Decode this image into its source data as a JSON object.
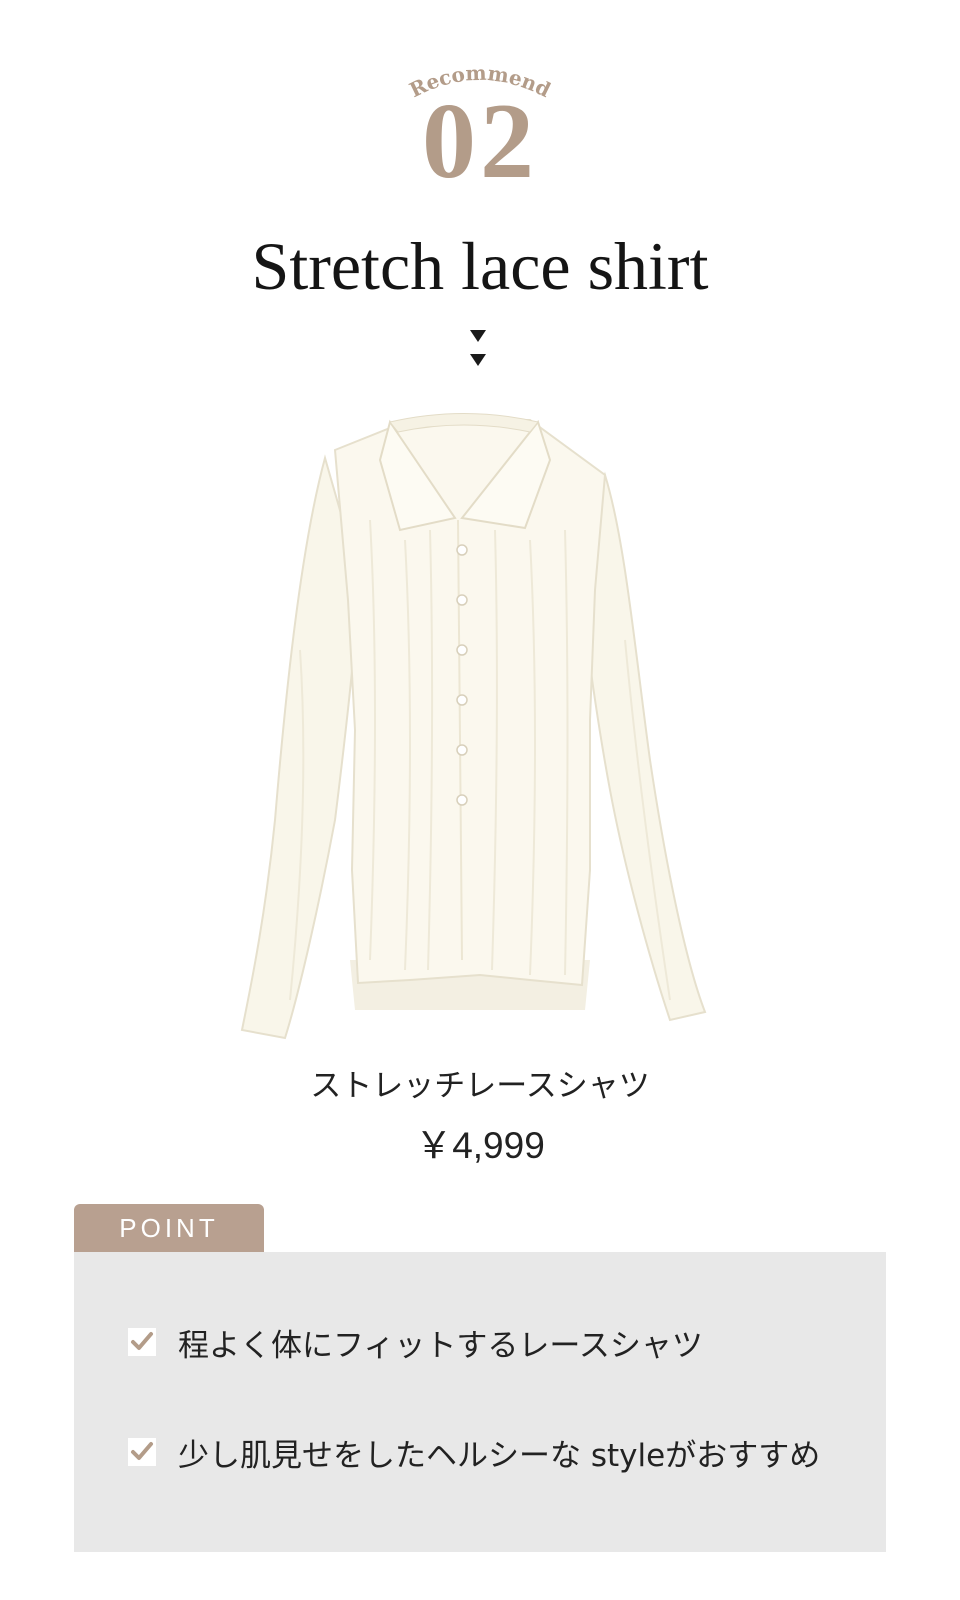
{
  "header": {
    "eyebrow": "Recommend",
    "number": "02",
    "title": "Stretch lace shirt"
  },
  "product": {
    "name": "ストレッチレースシャツ",
    "price": "￥4,999"
  },
  "point": {
    "label": "POINT",
    "items": [
      "程よく体にフィットするレースシャツ",
      "少し肌見せをしたヘルシーな styleがおすすめ"
    ]
  },
  "colors": {
    "accent": "#b39c89",
    "tab": "#b8a090",
    "box": "#e8e8e8",
    "shirt": "#fbf8ee"
  },
  "icons": [
    "down-arrow-icon",
    "check-icon"
  ]
}
